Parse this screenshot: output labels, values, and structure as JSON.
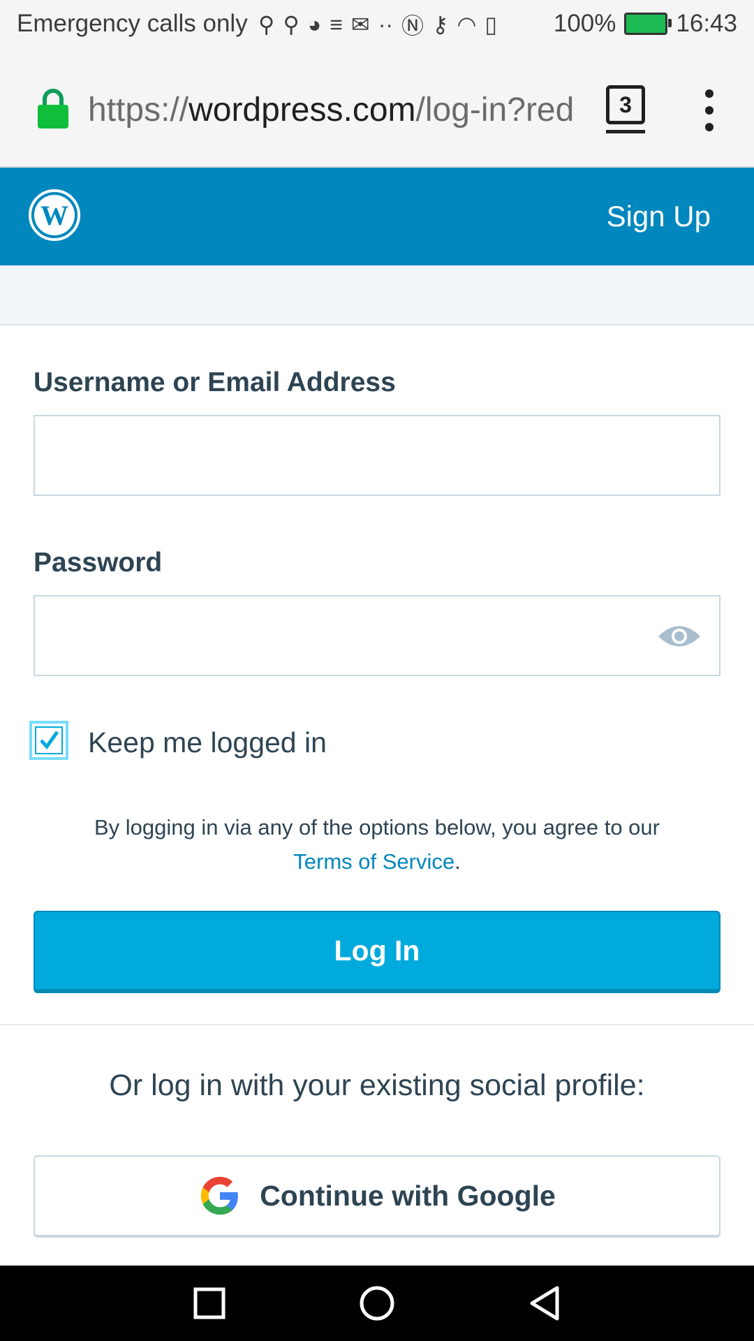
{
  "status_bar": {
    "carrier_text": "Emergency calls only",
    "battery": "100%",
    "time": "16:43",
    "icons": [
      "usb-icon",
      "usb-icon",
      "firefox-icon",
      "vpn-icon",
      "mail-icon",
      "more-dots-icon",
      "nfc-icon",
      "key-icon",
      "wifi-icon",
      "alert-icon"
    ]
  },
  "browser": {
    "url_prefix": "https://",
    "url_host": "wordpress.com",
    "url_path": "/log-in?red",
    "tabs_count": "3"
  },
  "header": {
    "signup_label": "Sign Up",
    "brand_color": "#0087be"
  },
  "form": {
    "username_label": "Username or Email Address",
    "username_value": "",
    "password_label": "Password",
    "password_value": "",
    "keep_logged_in_label": "Keep me logged in",
    "keep_logged_in_checked": true,
    "tos_text": "By logging in via any of the options below, you agree to our",
    "tos_link": "Terms of Service",
    "tos_period": ".",
    "login_button": "Log In",
    "accent_color": "#00aadc"
  },
  "social": {
    "prompt": "Or log in with your existing social profile:",
    "google_button": "Continue with Google"
  },
  "nav_bar": {
    "buttons": [
      "recents-square-icon",
      "home-circle-icon",
      "back-triangle-icon"
    ]
  }
}
